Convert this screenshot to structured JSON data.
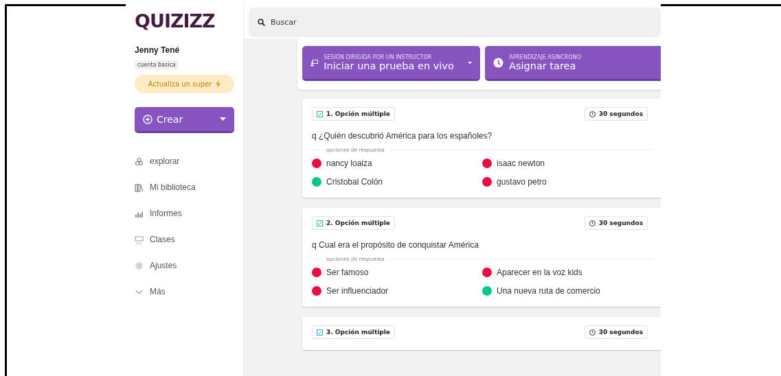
{
  "sidebar": {
    "logo": "QUIZIZZ",
    "user_name": "Jenny Tené",
    "account_badge": "cuenta basica",
    "upgrade_button": "Actualiza un super",
    "create_button": "Crear",
    "nav_items": [
      {
        "label": "explorar",
        "kind": "explore"
      },
      {
        "label": "Mi biblioteca",
        "kind": "library"
      },
      {
        "label": "Informes",
        "kind": "reports"
      },
      {
        "label": "Clases",
        "kind": "classes"
      },
      {
        "label": "Ajustes",
        "kind": "settings"
      },
      {
        "label": "Más",
        "kind": "more"
      }
    ]
  },
  "search": {
    "placeholder": "Buscar"
  },
  "actions": [
    {
      "kind": "live",
      "caption": "SESIÓN DIRIGIDA POR UN INSTRUCTOR",
      "label": "Iniciar una prueba en vivo"
    },
    {
      "kind": "homework",
      "caption": "APRENDIZAJE ASINCRONO",
      "label": "Asignar tarea"
    }
  ],
  "questions": [
    {
      "type_label": "1. Opción múltiple",
      "time": "30 segundos",
      "text": "q ¿Quién descubrió América para los españoles?",
      "options_heading": "opciones de respuesta",
      "options": [
        {
          "text": "nancy loaiza",
          "correct": false
        },
        {
          "text": "isaac newton",
          "correct": false
        },
        {
          "text": "Cristobal Colón",
          "correct": true
        },
        {
          "text": "gustavo petro",
          "correct": false
        }
      ]
    },
    {
      "type_label": "2. Opción múltiple",
      "time": "30 segundos",
      "text": "q Cual era el propósito de conquistar América",
      "options_heading": "opciones de respuesta",
      "options": [
        {
          "text": "Ser famoso",
          "correct": false
        },
        {
          "text": "Aparecer en la voz kids",
          "correct": false
        },
        {
          "text": "Ser influenciador",
          "correct": false
        },
        {
          "text": "Una nueva ruta de comercio",
          "correct": true
        }
      ]
    },
    {
      "type_label": "3. Opción múltiple",
      "time": "30 segundos"
    }
  ]
}
